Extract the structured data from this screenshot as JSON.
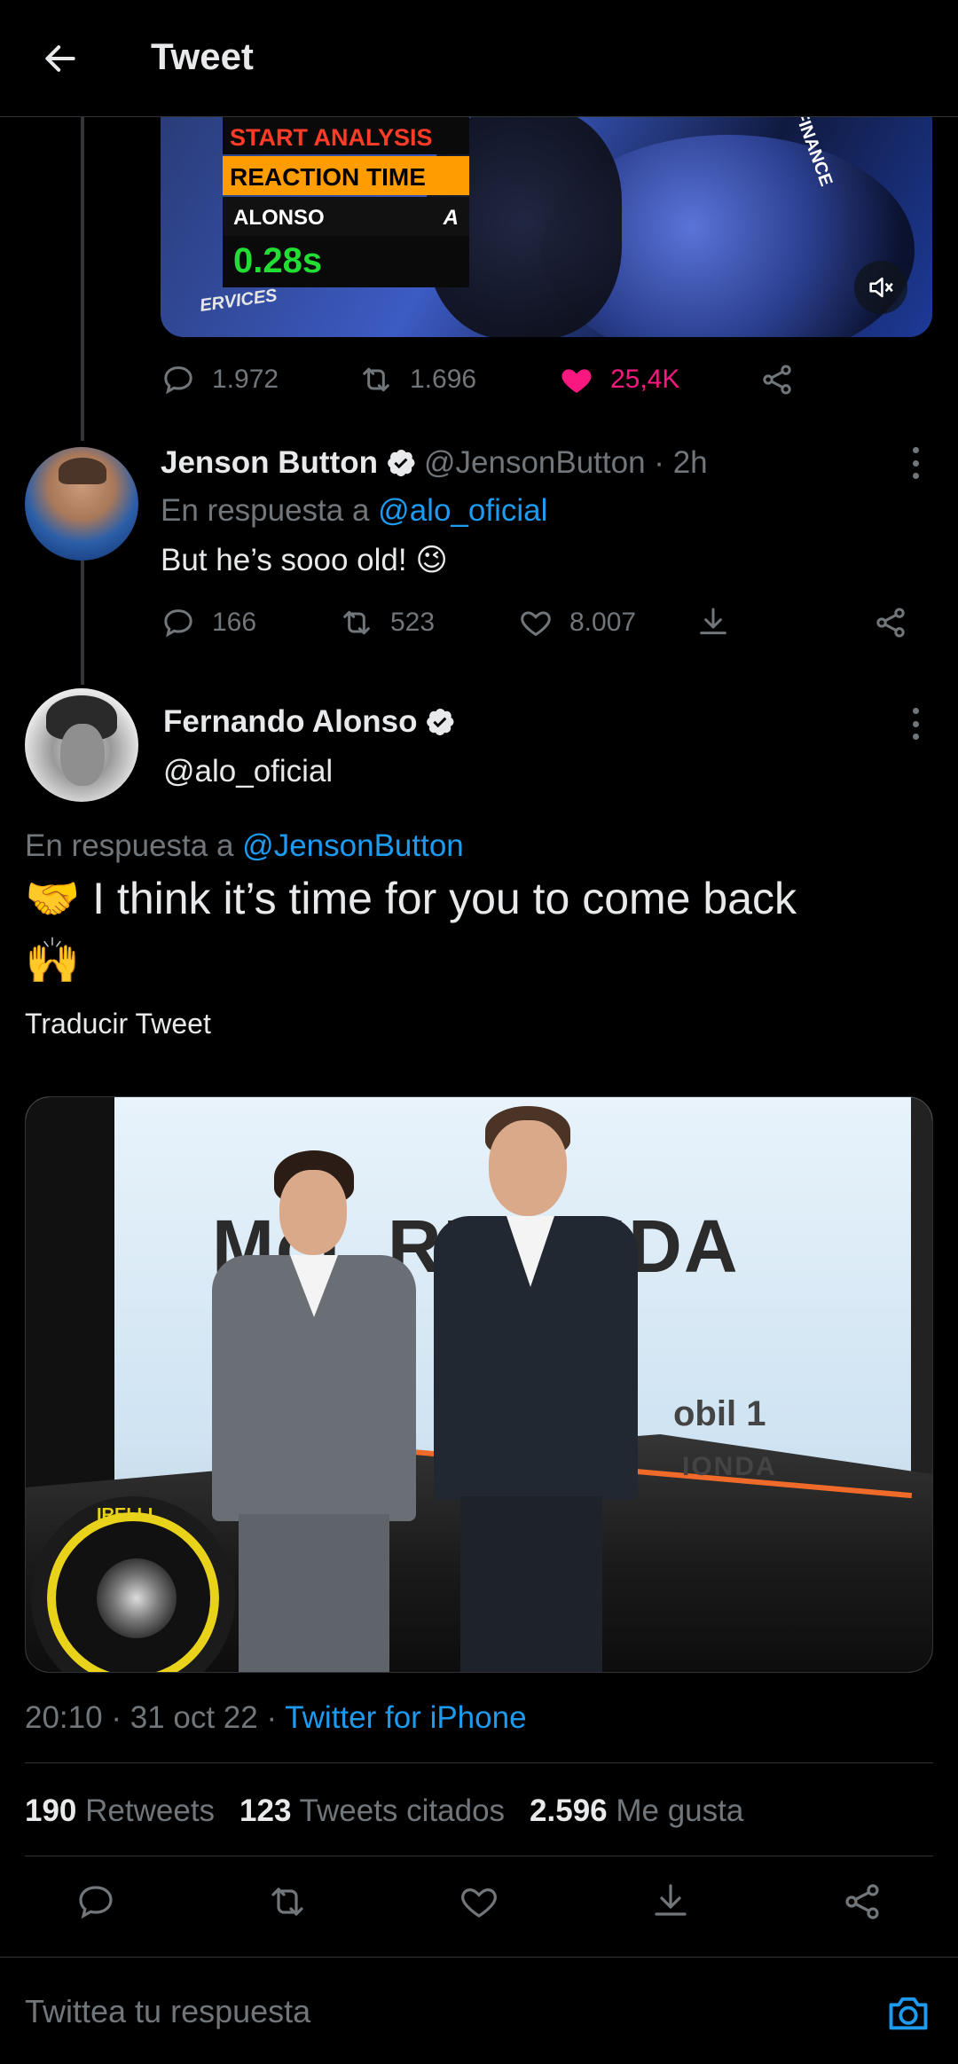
{
  "header": {
    "title": "Tweet"
  },
  "parent_tweet": {
    "video_overlay": {
      "line1": "START ANALYSIS",
      "line2": "REACTION TIME",
      "driver": "ALONSO",
      "team_mark": "A",
      "time": "0.28s",
      "sponsor_text": "ERVICES",
      "sponsor_text2": "FINANCE"
    },
    "replies": "1.972",
    "retweets": "1.696",
    "likes": "25,4K"
  },
  "reply_tweet": {
    "name": "Jenson Button",
    "handle": "@JensonButton",
    "time": "2h",
    "in_reply_prefix": "En respuesta a",
    "in_reply_handle": "@alo_oficial",
    "text": "But he’s sooo old! 😉",
    "replies": "166",
    "retweets": "523",
    "likes": "8.007"
  },
  "main_tweet": {
    "name": "Fernando Alonso",
    "handle": "@alo_oficial",
    "in_reply_prefix": "En respuesta a",
    "in_reply_handle": "@JensonButton",
    "text_line1": "🤝 I think it’s time for you to come back",
    "text_line2": "🙌",
    "translate": "Traducir Tweet",
    "photo": {
      "brand": "McL   REN   NDA",
      "sponsor1": "obil 1",
      "sponsor2": "IONDA",
      "tyre_brand": "IRELLI"
    },
    "time": "20:10",
    "date": "31 oct 22",
    "source": "Twitter for iPhone",
    "retweets_count": "190",
    "retweets_label": "Retweets",
    "quotes_count": "123",
    "quotes_label": "Tweets citados",
    "likes_count": "2.596",
    "likes_label": "Me gusta"
  },
  "reply_bar": {
    "placeholder": "Twittea tu respuesta"
  },
  "colors": {
    "accent": "#1d9bf0",
    "like": "#f91880",
    "muted": "#71767b",
    "background": "#000000"
  }
}
